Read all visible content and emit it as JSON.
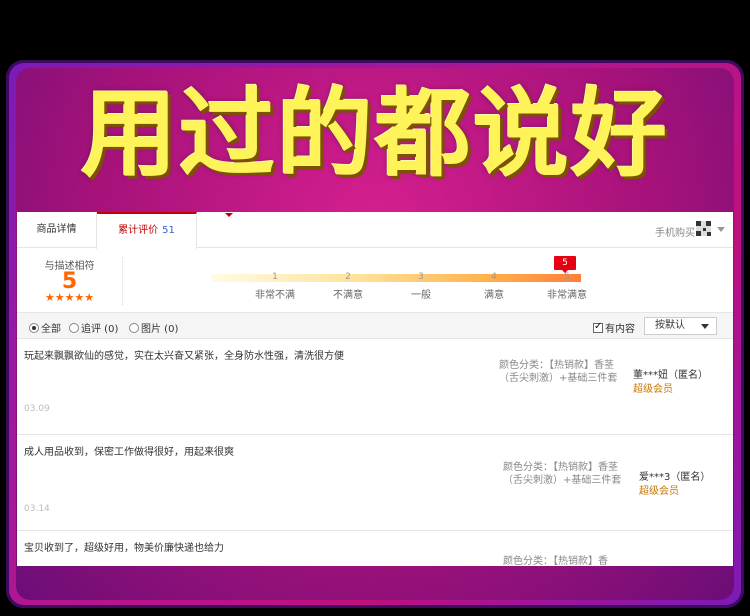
{
  "banner": {
    "headline": "用过的都说好"
  },
  "tabs": {
    "detail": "商品详情",
    "reviews": "累计评价",
    "review_count": "51",
    "mobile_buy": "手机购买"
  },
  "rating": {
    "label": "与描述相符",
    "score": "5",
    "stars": "★★★★★",
    "marker": "5",
    "scale": [
      {
        "num": "1",
        "label": "非常不满"
      },
      {
        "num": "2",
        "label": "不满意"
      },
      {
        "num": "3",
        "label": "一般"
      },
      {
        "num": "4",
        "label": "满意"
      },
      {
        "num": "5",
        "label": "非常满意"
      }
    ]
  },
  "filter": {
    "all": "全部",
    "followup": "追评 (0)",
    "pictures": "图片 (0)",
    "has_content": "有内容",
    "sort": "按默认"
  },
  "reviews": [
    {
      "content": "玩起来飘飘欲仙的感觉，实在太兴奋又紧张，全身防水性强，清洗很方便",
      "date": "03.09",
      "sku": "颜色分类：【热销款】香茎（舌尖刺激）+基础三件套",
      "user": "董***妞（匿名）",
      "level": "超级会员"
    },
    {
      "content": "成人用品收到，保密工作做得很好，用起来很爽",
      "date": "03.14",
      "sku": "颜色分类：【热销款】香茎（舌尖刺激）+基础三件套",
      "user": "爱***3（匿名）",
      "level": "超级会员"
    },
    {
      "content": "宝贝收到了，超级好用，物美价廉快递也给力",
      "date": "",
      "sku": "颜色分类：【热销款】香",
      "user": "",
      "level": ""
    }
  ]
}
